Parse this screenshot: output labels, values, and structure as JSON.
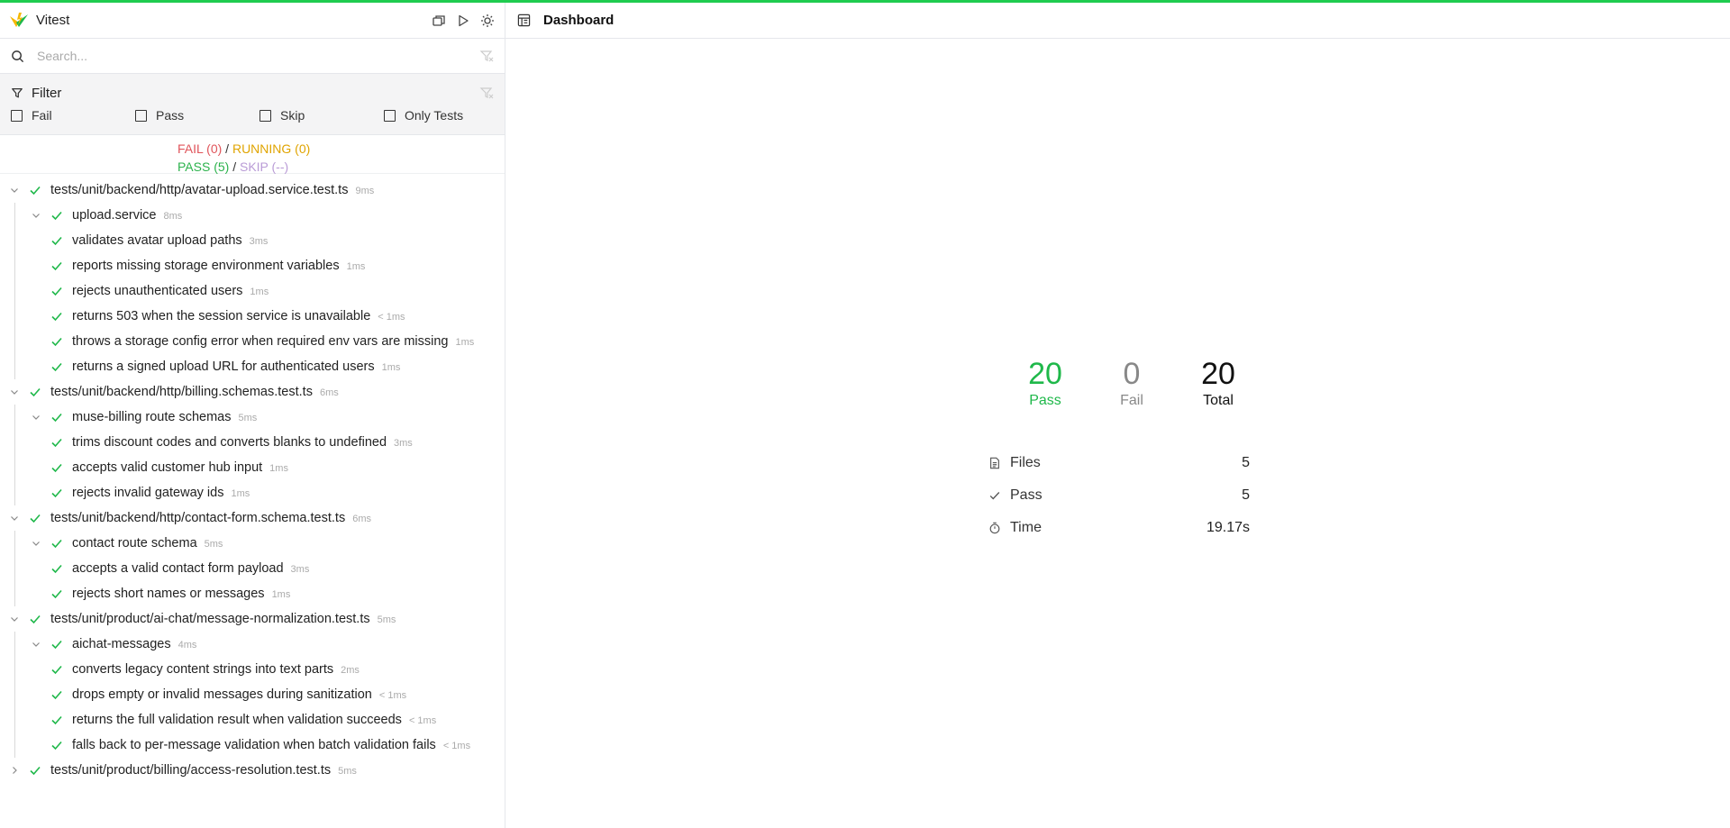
{
  "app": {
    "name": "Vitest"
  },
  "search": {
    "placeholder": "Search..."
  },
  "filter": {
    "title": "Filter",
    "options": [
      "Fail",
      "Pass",
      "Skip",
      "Only Tests"
    ]
  },
  "summary": {
    "fail": "FAIL (0)",
    "running": "RUNNING (0)",
    "pass": "PASS (5)",
    "skip": "SKIP (--)",
    "sep": "/"
  },
  "tree": [
    {
      "level": 0,
      "expanded": true,
      "name": "tests/unit/backend/http/avatar-upload.service.test.ts",
      "duration": "9ms"
    },
    {
      "level": 1,
      "expanded": true,
      "name": "upload.service",
      "duration": "8ms"
    },
    {
      "level": 2,
      "name": "validates avatar upload paths",
      "duration": "3ms"
    },
    {
      "level": 2,
      "name": "reports missing storage environment variables",
      "duration": "1ms"
    },
    {
      "level": 2,
      "name": "rejects unauthenticated users",
      "duration": "1ms"
    },
    {
      "level": 2,
      "name": "returns 503 when the session service is unavailable",
      "duration": "< 1ms"
    },
    {
      "level": 2,
      "name": "throws a storage config error when required env vars are missing",
      "duration": "1ms"
    },
    {
      "level": 2,
      "name": "returns a signed upload URL for authenticated users",
      "duration": "1ms"
    },
    {
      "level": 0,
      "expanded": true,
      "name": "tests/unit/backend/http/billing.schemas.test.ts",
      "duration": "6ms"
    },
    {
      "level": 1,
      "expanded": true,
      "name": "muse-billing route schemas",
      "duration": "5ms"
    },
    {
      "level": 2,
      "name": "trims discount codes and converts blanks to undefined",
      "duration": "3ms"
    },
    {
      "level": 2,
      "name": "accepts valid customer hub input",
      "duration": "1ms"
    },
    {
      "level": 2,
      "name": "rejects invalid gateway ids",
      "duration": "1ms"
    },
    {
      "level": 0,
      "expanded": true,
      "name": "tests/unit/backend/http/contact-form.schema.test.ts",
      "duration": "6ms"
    },
    {
      "level": 1,
      "expanded": true,
      "name": "contact route schema",
      "duration": "5ms"
    },
    {
      "level": 2,
      "name": "accepts a valid contact form payload",
      "duration": "3ms"
    },
    {
      "level": 2,
      "name": "rejects short names or messages",
      "duration": "1ms"
    },
    {
      "level": 0,
      "expanded": true,
      "name": "tests/unit/product/ai-chat/message-normalization.test.ts",
      "duration": "5ms"
    },
    {
      "level": 1,
      "expanded": true,
      "name": "aichat-messages",
      "duration": "4ms"
    },
    {
      "level": 2,
      "name": "converts legacy content strings into text parts",
      "duration": "2ms"
    },
    {
      "level": 2,
      "name": "drops empty or invalid messages during sanitization",
      "duration": "< 1ms"
    },
    {
      "level": 2,
      "name": "returns the full validation result when validation succeeds",
      "duration": "< 1ms"
    },
    {
      "level": 2,
      "name": "falls back to per-message validation when batch validation fails",
      "duration": "< 1ms"
    },
    {
      "level": 0,
      "expanded": false,
      "name": "tests/unit/product/billing/access-resolution.test.ts",
      "duration": "5ms"
    }
  ],
  "main": {
    "title": "Dashboard"
  },
  "stats": {
    "pass": {
      "value": "20",
      "label": "Pass"
    },
    "fail": {
      "value": "0",
      "label": "Fail"
    },
    "total": {
      "value": "20",
      "label": "Total"
    }
  },
  "details": [
    {
      "icon": "file-icon",
      "label": "Files",
      "value": "5"
    },
    {
      "icon": "check-icon",
      "label": "Pass",
      "value": "5"
    },
    {
      "icon": "timer-icon",
      "label": "Time",
      "value": "19.17s"
    }
  ],
  "colors": {
    "accent": "#1fcc4f",
    "pass": "#1fb84a",
    "fail": "#e0555b",
    "running": "#e0a400",
    "skip": "#b99bd6"
  }
}
